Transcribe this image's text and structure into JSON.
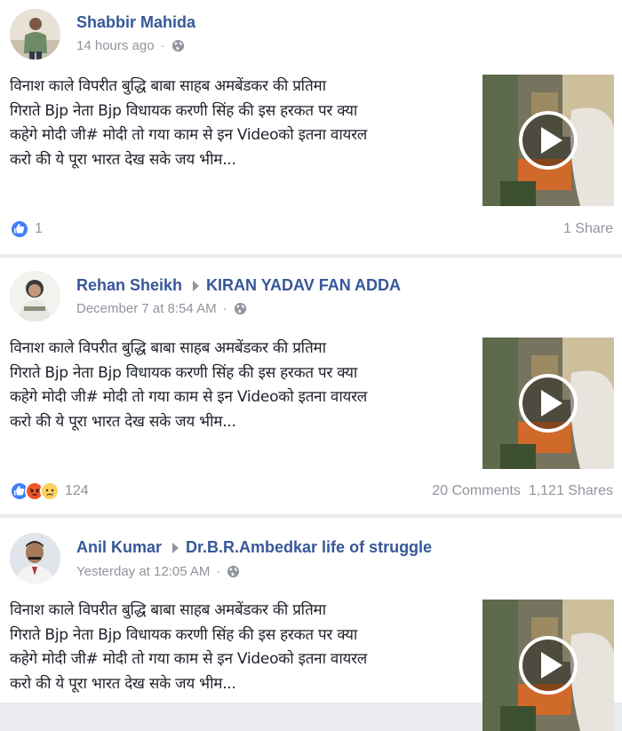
{
  "posts": [
    {
      "author": "Shabbir Mahida",
      "group": "",
      "timestamp": "14 hours ago",
      "privacy_icon": "globe-icon",
      "text_lines": [
        "विनाश काले विपरीत बुद्धि बाबा साहब अमबेंडकर की प्रतिमा",
        "गिराते Bjp नेता Bjp विधायक करणी सिंह की इस हरकत पर क्या",
        "कहेगे मोदी जी# मोदी तो गया काम से इन Videoको इतना वायरल",
        "करो की ये पूरा भारत देख सके जय भीम..."
      ],
      "reaction_icons": [
        "like-icon"
      ],
      "reaction_count": "1",
      "comments": "",
      "shares": "1 Share"
    },
    {
      "author": "Rehan Sheikh",
      "group": "KIRAN YADAV FAN ADDA",
      "timestamp": "December 7 at 8:54 AM",
      "privacy_icon": "globe-icon",
      "text_lines": [
        "विनाश काले विपरीत बुद्धि बाबा साहब अमबेंडकर की प्रतिमा",
        "गिराते Bjp नेता Bjp विधायक करणी सिंह की इस हरकत पर क्या",
        "कहेगे मोदी जी# मोदी तो गया काम से इन Videoको इतना वायरल",
        "करो की ये पूरा भारत देख सके जय भीम..."
      ],
      "reaction_icons": [
        "like-icon",
        "angry-icon",
        "sad-icon"
      ],
      "reaction_count": "124",
      "comments": "20 Comments",
      "shares": "1,121 Shares"
    },
    {
      "author": "Anil Kumar",
      "group": "Dr.B.R.Ambedkar life of struggle",
      "timestamp": "Yesterday at 12:05 AM",
      "privacy_icon": "globe-icon",
      "text_lines": [
        "विनाश काले विपरीत बुद्धि बाबा साहब अमबेंडकर की प्रतिमा",
        "गिराते Bjp नेता Bjp विधायक करणी सिंह की इस हरकत पर क्या",
        "कहेगे मोदी जी# मोदी तो गया काम से इन Videoको इतना वायरल",
        "करो की ये पूरा भारत देख सके जय भीम..."
      ]
    }
  ],
  "colors": {
    "link_blue": "#365899",
    "meta_gray": "#90949c",
    "like_blue": "#4080ff",
    "angry_orange": "#f0532a",
    "sad_yellow": "#fcd15c",
    "feed_background": "#e9ebee"
  },
  "icons": {
    "video_play": "play-icon",
    "separator_arrow": "triangle-right-icon"
  }
}
